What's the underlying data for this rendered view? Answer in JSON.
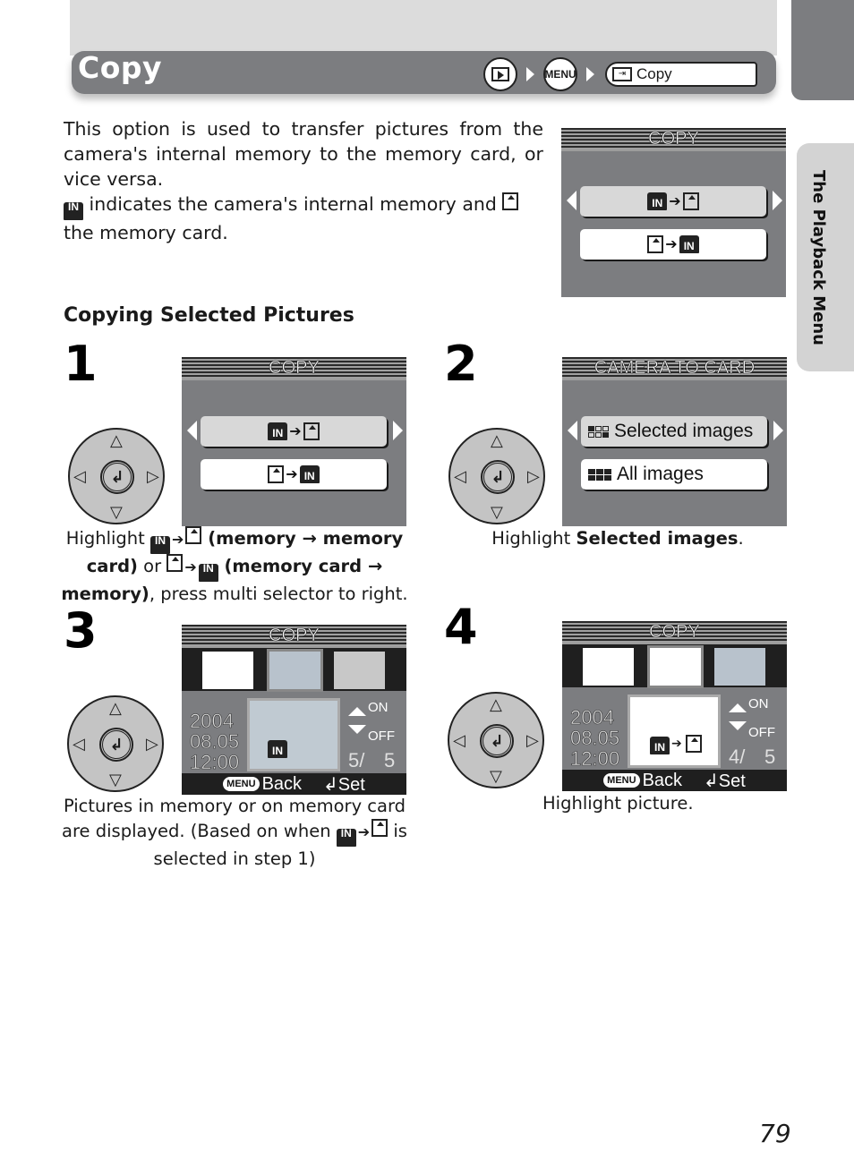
{
  "header": {
    "title": "Copy",
    "breadcrumb": [
      {
        "icon": "playback-icon"
      },
      {
        "label": "MENU"
      },
      {
        "label": "Copy",
        "icon": "copy-icon"
      }
    ]
  },
  "side_tab": {
    "label": "The Playback Menu"
  },
  "intro": {
    "paragraph1": "This option is used to transfer pictures from the camera's internal memory to the memory card, or vice versa.",
    "paragraph2_mid": " indicates the camera's internal memory and ",
    "paragraph2_end": " the memory card."
  },
  "intro_screen": {
    "title": "COPY",
    "options": [
      {
        "label": "IN → card",
        "selected": true
      },
      {
        "label": "card → IN",
        "selected": false
      }
    ]
  },
  "section": {
    "heading": "Copying Selected Pictures"
  },
  "icons": {
    "in_label": "IN",
    "arrow": "➔"
  },
  "steps": [
    {
      "number": "1",
      "screen": {
        "title": "COPY",
        "options": [
          "IN → card",
          "card → IN"
        ],
        "selected_index": 0
      },
      "caption": {
        "p1": "Highlight ",
        "p2": " (memory → memory card)",
        "p3": " or ",
        "p4": " (memory card → memory)",
        "p5": ", press multi selector to right."
      }
    },
    {
      "number": "2",
      "screen": {
        "title": "CAMERA TO CARD",
        "options": [
          "Selected images",
          "All images"
        ],
        "selected_index": 0
      },
      "caption": {
        "p1": "Highlight ",
        "bold": "Selected images",
        "p2": "."
      }
    },
    {
      "number": "3",
      "screen": {
        "title": "COPY",
        "date": "2004",
        "day": "08.05",
        "time": "12:00",
        "on_label": "ON",
        "off_label": "OFF",
        "counter_current": "5/",
        "counter_total": "5",
        "back_label": "Back",
        "set_label": "Set",
        "menu_label": "MENU"
      },
      "caption": {
        "line1": "Pictures in memory or on memory card",
        "line2a": "are displayed. (Based on when ",
        "line2b": " is",
        "line3": "selected in step 1)"
      }
    },
    {
      "number": "4",
      "screen": {
        "title": "COPY",
        "date": "2004",
        "day": "08.05",
        "time": "12:00",
        "on_label": "ON",
        "off_label": "OFF",
        "counter_current": "4/",
        "counter_total": "5",
        "back_label": "Back",
        "set_label": "Set",
        "menu_label": "MENU"
      },
      "caption": {
        "text": "Highlight picture."
      }
    }
  ],
  "page_number": "79"
}
